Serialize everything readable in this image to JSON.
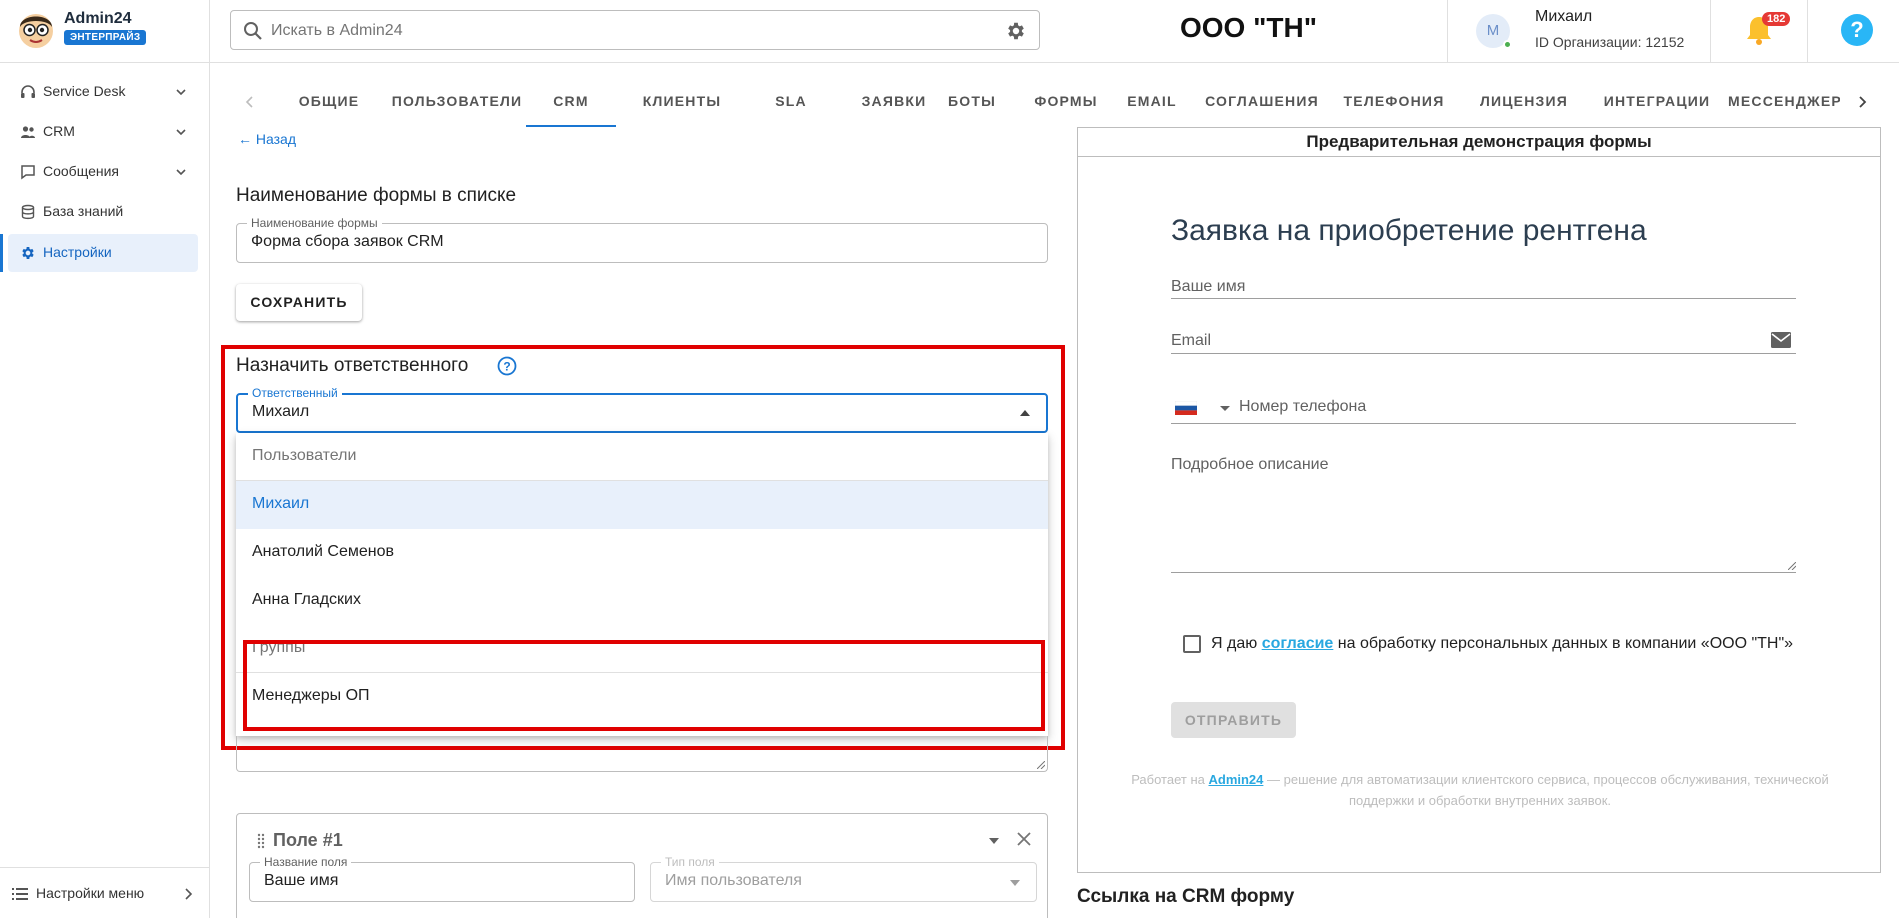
{
  "brand": {
    "name": "Admin24",
    "plan": "ЭНТЕРПРАЙЗ"
  },
  "search": {
    "placeholder": "Искать в Admin24"
  },
  "header": {
    "org_title": "ООО \"ТН\""
  },
  "user": {
    "avatar_letter": "М",
    "name": "Михаил",
    "org_id": "ID Организации: 12152"
  },
  "notifications": {
    "count": "182"
  },
  "help": {
    "label": "?"
  },
  "sidebar": {
    "items": [
      {
        "label": "Service Desk",
        "icon": "headset-icon",
        "expandable": true
      },
      {
        "label": "CRM",
        "icon": "people-icon",
        "expandable": true
      },
      {
        "label": "Сообщения",
        "icon": "chat-icon",
        "expandable": true
      },
      {
        "label": "База знаний",
        "icon": "database-icon",
        "expandable": false
      },
      {
        "label": "Настройки",
        "icon": "gear-icon",
        "expandable": false,
        "active": true
      }
    ],
    "bottom": {
      "label": "Настройки меню"
    }
  },
  "tabs": [
    {
      "label": "ОБЩИЕ"
    },
    {
      "label": "ПОЛЬЗОВАТЕЛИ"
    },
    {
      "label": "CRM",
      "active": true
    },
    {
      "label": "КЛИЕНТЫ"
    },
    {
      "label": "SLA"
    },
    {
      "label": "ЗАЯВКИ"
    },
    {
      "label": "БОТЫ"
    },
    {
      "label": "ФОРМЫ"
    },
    {
      "label": "EMAIL"
    },
    {
      "label": "СОГЛАШЕНИЯ"
    },
    {
      "label": "ТЕЛЕФОНИЯ"
    },
    {
      "label": "ЛИЦЕНЗИЯ"
    },
    {
      "label": "ИНТЕГРАЦИИ"
    },
    {
      "label": "МЕССЕНДЖЕРЫ"
    }
  ],
  "editor": {
    "back_label": "Назад",
    "form_name_section": "Наименование формы в списке",
    "form_name_field_label": "Наименование формы",
    "form_name_value": "Форма сбора заявок CRM",
    "save_label": "СОХРАНИТЬ",
    "assign_section": "Назначить ответственного",
    "responsible_label": "Ответственный",
    "responsible_value": "Михаил",
    "dropdown": {
      "users_header": "Пользователи",
      "users": [
        "Михаил",
        "Анатолий Семенов",
        "Анна Гладских"
      ],
      "groups_header": "Группы",
      "groups": [
        "Менеджеры ОП"
      ]
    },
    "field_card": {
      "title": "Поле #1",
      "name_label": "Название поля",
      "name_value": "Ваше имя",
      "type_label": "Тип поля",
      "type_value": "Имя пользователя"
    }
  },
  "preview": {
    "title": "Предварительная демонстрация формы",
    "heading": "Заявка на приобретение рентгена",
    "name_label": "Ваше имя",
    "email_label": "Email",
    "phone_label": "Номер телефона",
    "description_label": "Подробное описание",
    "consent_before": "Я даю ",
    "consent_link": "согласие",
    "consent_after": " на обработку персональных данных в компании «ООО \"ТН\"»",
    "submit_label": "ОТПРАВИТЬ",
    "footer_before": "Работает на ",
    "footer_brand": "Admin24",
    "footer_after": " — решение для автоматизации клиентского сервиса, процессов обслуживания, технической поддержки и обработки внутренних заявок."
  },
  "crm_link_title": "Ссылка на CRM форму",
  "colors": {
    "accent": "#1976d2",
    "highlight": "#e00000",
    "link": "#29a8e0",
    "badge": "#e53935"
  }
}
